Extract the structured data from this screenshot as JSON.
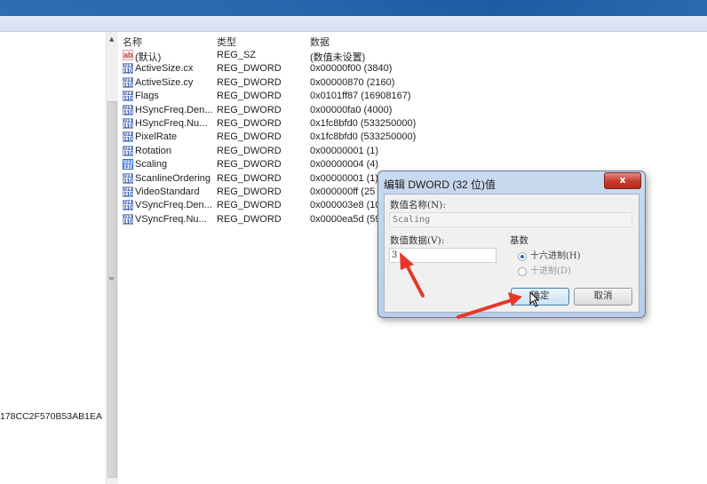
{
  "window": {
    "title_bar_color": "#2a66ad"
  },
  "tree": {
    "visible_key_fragment": "178CC2F570B53AB1EA"
  },
  "list": {
    "columns": [
      "名称",
      "类型",
      "数据"
    ],
    "rows": [
      {
        "icon": "string-value-icon",
        "name": "(默认)",
        "type": "REG_SZ",
        "data": "(数值未设置)"
      },
      {
        "icon": "dword-value-icon",
        "name": "ActiveSize.cx",
        "type": "REG_DWORD",
        "data": "0x00000f00 (3840)"
      },
      {
        "icon": "dword-value-icon",
        "name": "ActiveSize.cy",
        "type": "REG_DWORD",
        "data": "0x00000870 (2160)"
      },
      {
        "icon": "dword-value-icon",
        "name": "Flags",
        "type": "REG_DWORD",
        "data": "0x0101ff87 (16908167)"
      },
      {
        "icon": "dword-value-icon",
        "name": "HSyncFreq.Den...",
        "type": "REG_DWORD",
        "data": "0x00000fa0 (4000)"
      },
      {
        "icon": "dword-value-icon",
        "name": "HSyncFreq.Nu...",
        "type": "REG_DWORD",
        "data": "0x1fc8bfd0 (533250000)"
      },
      {
        "icon": "dword-value-icon",
        "name": "PixelRate",
        "type": "REG_DWORD",
        "data": "0x1fc8bfd0 (533250000)"
      },
      {
        "icon": "dword-value-icon",
        "name": "Rotation",
        "type": "REG_DWORD",
        "data": "0x00000001 (1)"
      },
      {
        "icon": "dword-value-icon",
        "name": "Scaling",
        "type": "REG_DWORD",
        "data": "0x00000004 (4)",
        "selected": true
      },
      {
        "icon": "dword-value-icon",
        "name": "ScanlineOrdering",
        "type": "REG_DWORD",
        "data": "0x00000001 (1)"
      },
      {
        "icon": "dword-value-icon",
        "name": "VideoStandard",
        "type": "REG_DWORD",
        "data": "0x000000ff (25"
      },
      {
        "icon": "dword-value-icon",
        "name": "VSyncFreq.Den...",
        "type": "REG_DWORD",
        "data": "0x000003e8 (10"
      },
      {
        "icon": "dword-value-icon",
        "name": "VSyncFreq.Nu...",
        "type": "REG_DWORD",
        "data": "0x0000ea5d (59"
      }
    ]
  },
  "dialog": {
    "title": "编辑 DWORD (32 位)值",
    "close_label": "x",
    "value_name_label": "数值名称(N):",
    "value_name": "Scaling",
    "value_data_label": "数值数据(V):",
    "value_data": "3",
    "base_label": "基数",
    "base_options": [
      {
        "label": "十六进制(H)",
        "checked": true
      },
      {
        "label": "十进制(D)",
        "checked": false
      }
    ],
    "ok_label": "确定",
    "cancel_label": "取消"
  },
  "annotations": {
    "arrow_color": "#e8372a"
  }
}
